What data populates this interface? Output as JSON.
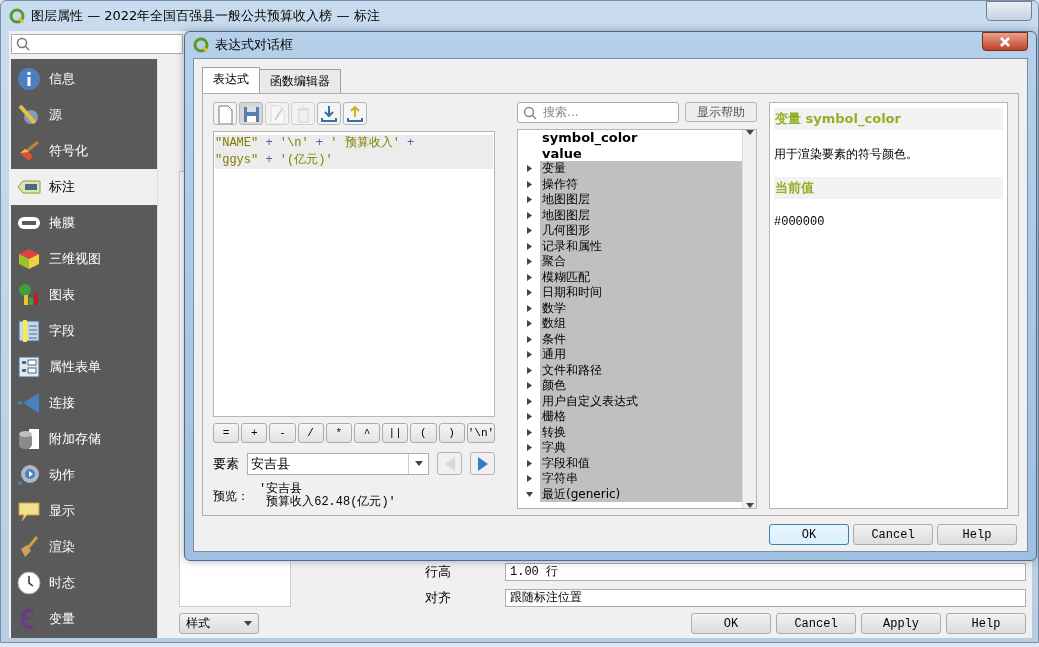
{
  "window": {
    "title": "图层属性 — 2022年全国百强县一般公共预算收入榜 — 标注"
  },
  "sidebar": {
    "items": [
      {
        "label": "信息",
        "selected": false
      },
      {
        "label": "源",
        "selected": false
      },
      {
        "label": "符号化",
        "selected": false
      },
      {
        "label": "标注",
        "selected": true
      },
      {
        "label": "掩膜",
        "selected": false
      },
      {
        "label": "三维视图",
        "selected": false
      },
      {
        "label": "图表",
        "selected": false
      },
      {
        "label": "字段",
        "selected": false
      },
      {
        "label": "属性表单",
        "selected": false
      },
      {
        "label": "连接",
        "selected": false
      },
      {
        "label": "附加存储",
        "selected": false
      },
      {
        "label": "动作",
        "selected": false
      },
      {
        "label": "显示",
        "selected": false
      },
      {
        "label": "渲染",
        "selected": false
      },
      {
        "label": "时态",
        "selected": false
      },
      {
        "label": "变量",
        "selected": false
      }
    ]
  },
  "content": {
    "rows": [
      {
        "label": "行高",
        "value": "1.00 行"
      },
      {
        "label": "对齐",
        "value": "跟随标注位置"
      }
    ]
  },
  "bottom_bar": {
    "style_menu": "样式",
    "buttons": [
      "OK",
      "Cancel",
      "Apply",
      "Help"
    ]
  },
  "dialog": {
    "title": "表达式对话框",
    "tabs": [
      {
        "label": "表达式",
        "selected": true
      },
      {
        "label": "函数编辑器",
        "selected": false
      }
    ],
    "toolbar": [
      {
        "kind": "new",
        "disabled": false
      },
      {
        "kind": "save",
        "disabled": false
      },
      {
        "kind": "edit",
        "disabled": true
      },
      {
        "kind": "delete",
        "disabled": true
      },
      {
        "kind": "import",
        "disabled": false
      },
      {
        "kind": "export",
        "disabled": false
      }
    ],
    "expression": [
      [
        {
          "kind": "field",
          "text": "\"NAME\""
        },
        {
          "kind": "op",
          "text": " + "
        },
        {
          "kind": "string",
          "text": "'\\n'"
        },
        {
          "kind": "op",
          "text": " + "
        },
        {
          "kind": "string",
          "text": "' 预算收入'"
        },
        {
          "kind": "op",
          "text": " +"
        }
      ],
      [
        {
          "kind": "field",
          "text": "\"ggys\""
        },
        {
          "kind": "op",
          "text": " + "
        },
        {
          "kind": "string",
          "text": "'(亿元)'"
        }
      ]
    ],
    "operators": [
      "=",
      "+",
      "-",
      "/",
      "*",
      "^",
      "||",
      "(",
      ")",
      "'\\n'"
    ],
    "feature": {
      "label": "要素",
      "value": "安吉县",
      "prev_disabled": true,
      "next_disabled": false
    },
    "preview": {
      "label": "预览：",
      "lines": [
        "'安吉县",
        "预算收入62.48(亿元)'"
      ]
    },
    "search": {
      "placeholder": "搜索...",
      "help_button": "显示帮助"
    },
    "tree": [
      {
        "kind": "variable",
        "label": "symbol_color"
      },
      {
        "kind": "variable",
        "label": "value"
      },
      {
        "kind": "group",
        "label": "变量",
        "expanded": false
      },
      {
        "kind": "group",
        "label": "操作符",
        "expanded": false
      },
      {
        "kind": "group",
        "label": "地图图层",
        "expanded": false
      },
      {
        "kind": "group",
        "label": "地图图层",
        "expanded": false
      },
      {
        "kind": "group",
        "label": "几何图形",
        "expanded": false
      },
      {
        "kind": "group",
        "label": "记录和属性",
        "expanded": false
      },
      {
        "kind": "group",
        "label": "聚合",
        "expanded": false
      },
      {
        "kind": "group",
        "label": "模糊匹配",
        "expanded": false
      },
      {
        "kind": "group",
        "label": "日期和时间",
        "expanded": false
      },
      {
        "kind": "group",
        "label": "数学",
        "expanded": false
      },
      {
        "kind": "group",
        "label": "数组",
        "expanded": false
      },
      {
        "kind": "group",
        "label": "条件",
        "expanded": false
      },
      {
        "kind": "group",
        "label": "通用",
        "expanded": false
      },
      {
        "kind": "group",
        "label": "文件和路径",
        "expanded": false
      },
      {
        "kind": "group",
        "label": "颜色",
        "expanded": false
      },
      {
        "kind": "group",
        "label": "用户自定义表达式",
        "expanded": false
      },
      {
        "kind": "group",
        "label": "栅格",
        "expanded": false
      },
      {
        "kind": "group",
        "label": "转换",
        "expanded": false
      },
      {
        "kind": "group",
        "label": "字典",
        "expanded": false
      },
      {
        "kind": "group",
        "label": "字段和值",
        "expanded": false
      },
      {
        "kind": "group",
        "label": "字符串",
        "expanded": false
      },
      {
        "kind": "group",
        "label": "最近(generic)",
        "expanded": true
      }
    ],
    "help": {
      "title": "变量 symbol_color",
      "description": "用于渲染要素的符号颜色。",
      "section": "当前值",
      "value": "#000000"
    },
    "buttons": [
      "OK",
      "Cancel",
      "Help"
    ]
  }
}
